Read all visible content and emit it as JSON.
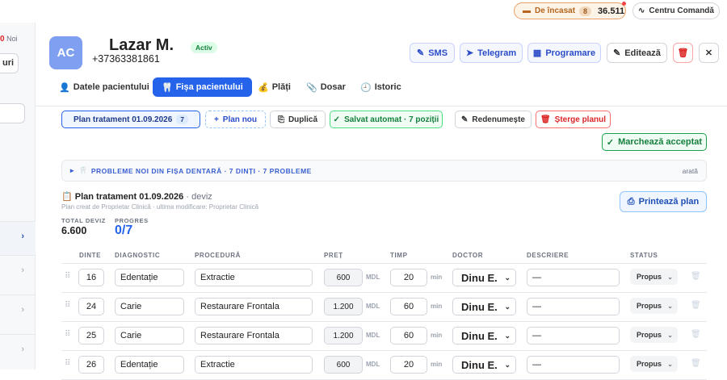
{
  "topbar": {
    "due_label": "De încasat",
    "due_count": "8",
    "due_amount": "36.511",
    "command_label": "Centru Comandă"
  },
  "sidebar": {
    "new_count": "0",
    "new_label": "Noi",
    "btn_label": "uri"
  },
  "patient": {
    "initials": "AC",
    "name": "Lazar M.",
    "phone": "+37363381861",
    "status": "Activ"
  },
  "actions": {
    "sms": "SMS",
    "telegram": "Telegram",
    "appointment": "Programare",
    "edit": "Editează"
  },
  "tabs": [
    "Datele pacientului",
    "Fișa pacientului",
    "Plăți",
    "Dosar",
    "Istoric"
  ],
  "plan_bar": {
    "plan_name": "Plan tratament 01.09.2026",
    "plan_count": "7",
    "new_plan": "Plan nou",
    "duplicate": "Duplică",
    "autosaved": "Salvat automat · 7 poziții",
    "rename": "Redenumește",
    "delete": "Șterge planul",
    "accept": "Marchează acceptat"
  },
  "banner": {
    "text": "PROBLEME NOI DIN FIȘA DENTARĂ · 7 DINȚI · 7 PROBLEME",
    "show": "arată"
  },
  "plan": {
    "title": "Plan tratament 01.09.2026",
    "title_suffix": "· deviz",
    "subtitle": "Plan creat de Proprietar Clinică · ultima modificare: Proprietar Clinică",
    "total_label": "TOTAL DEVIZ",
    "total_value": "6.600",
    "progress_label": "PROGRES",
    "progress_value": "0/7",
    "print": "Printează plan"
  },
  "table": {
    "headers": [
      "DINTE",
      "DIAGNOSTIC",
      "PROCEDURĂ",
      "PREȚ",
      "TIMP",
      "DOCTOR",
      "DESCRIERE",
      "STATUS"
    ],
    "currency": "MDL",
    "time_unit": "min",
    "rows": [
      {
        "tooth": "16",
        "diagnosis": "Edentație",
        "procedure": "Extractie",
        "price": "600",
        "time": "20",
        "doctor": "Dinu E.",
        "description": "—",
        "status": "Propus"
      },
      {
        "tooth": "24",
        "diagnosis": "Carie",
        "procedure": "Restaurare Frontala",
        "price": "1.200",
        "time": "60",
        "doctor": "Dinu E.",
        "description": "—",
        "status": "Propus"
      },
      {
        "tooth": "25",
        "diagnosis": "Carie",
        "procedure": "Restaurare Frontala",
        "price": "1.200",
        "time": "60",
        "doctor": "Dinu E.",
        "description": "—",
        "status": "Propus"
      },
      {
        "tooth": "26",
        "diagnosis": "Edentație",
        "procedure": "Extractie",
        "price": "600",
        "time": "20",
        "doctor": "Dinu E.",
        "description": "—",
        "status": "Propus"
      }
    ]
  }
}
